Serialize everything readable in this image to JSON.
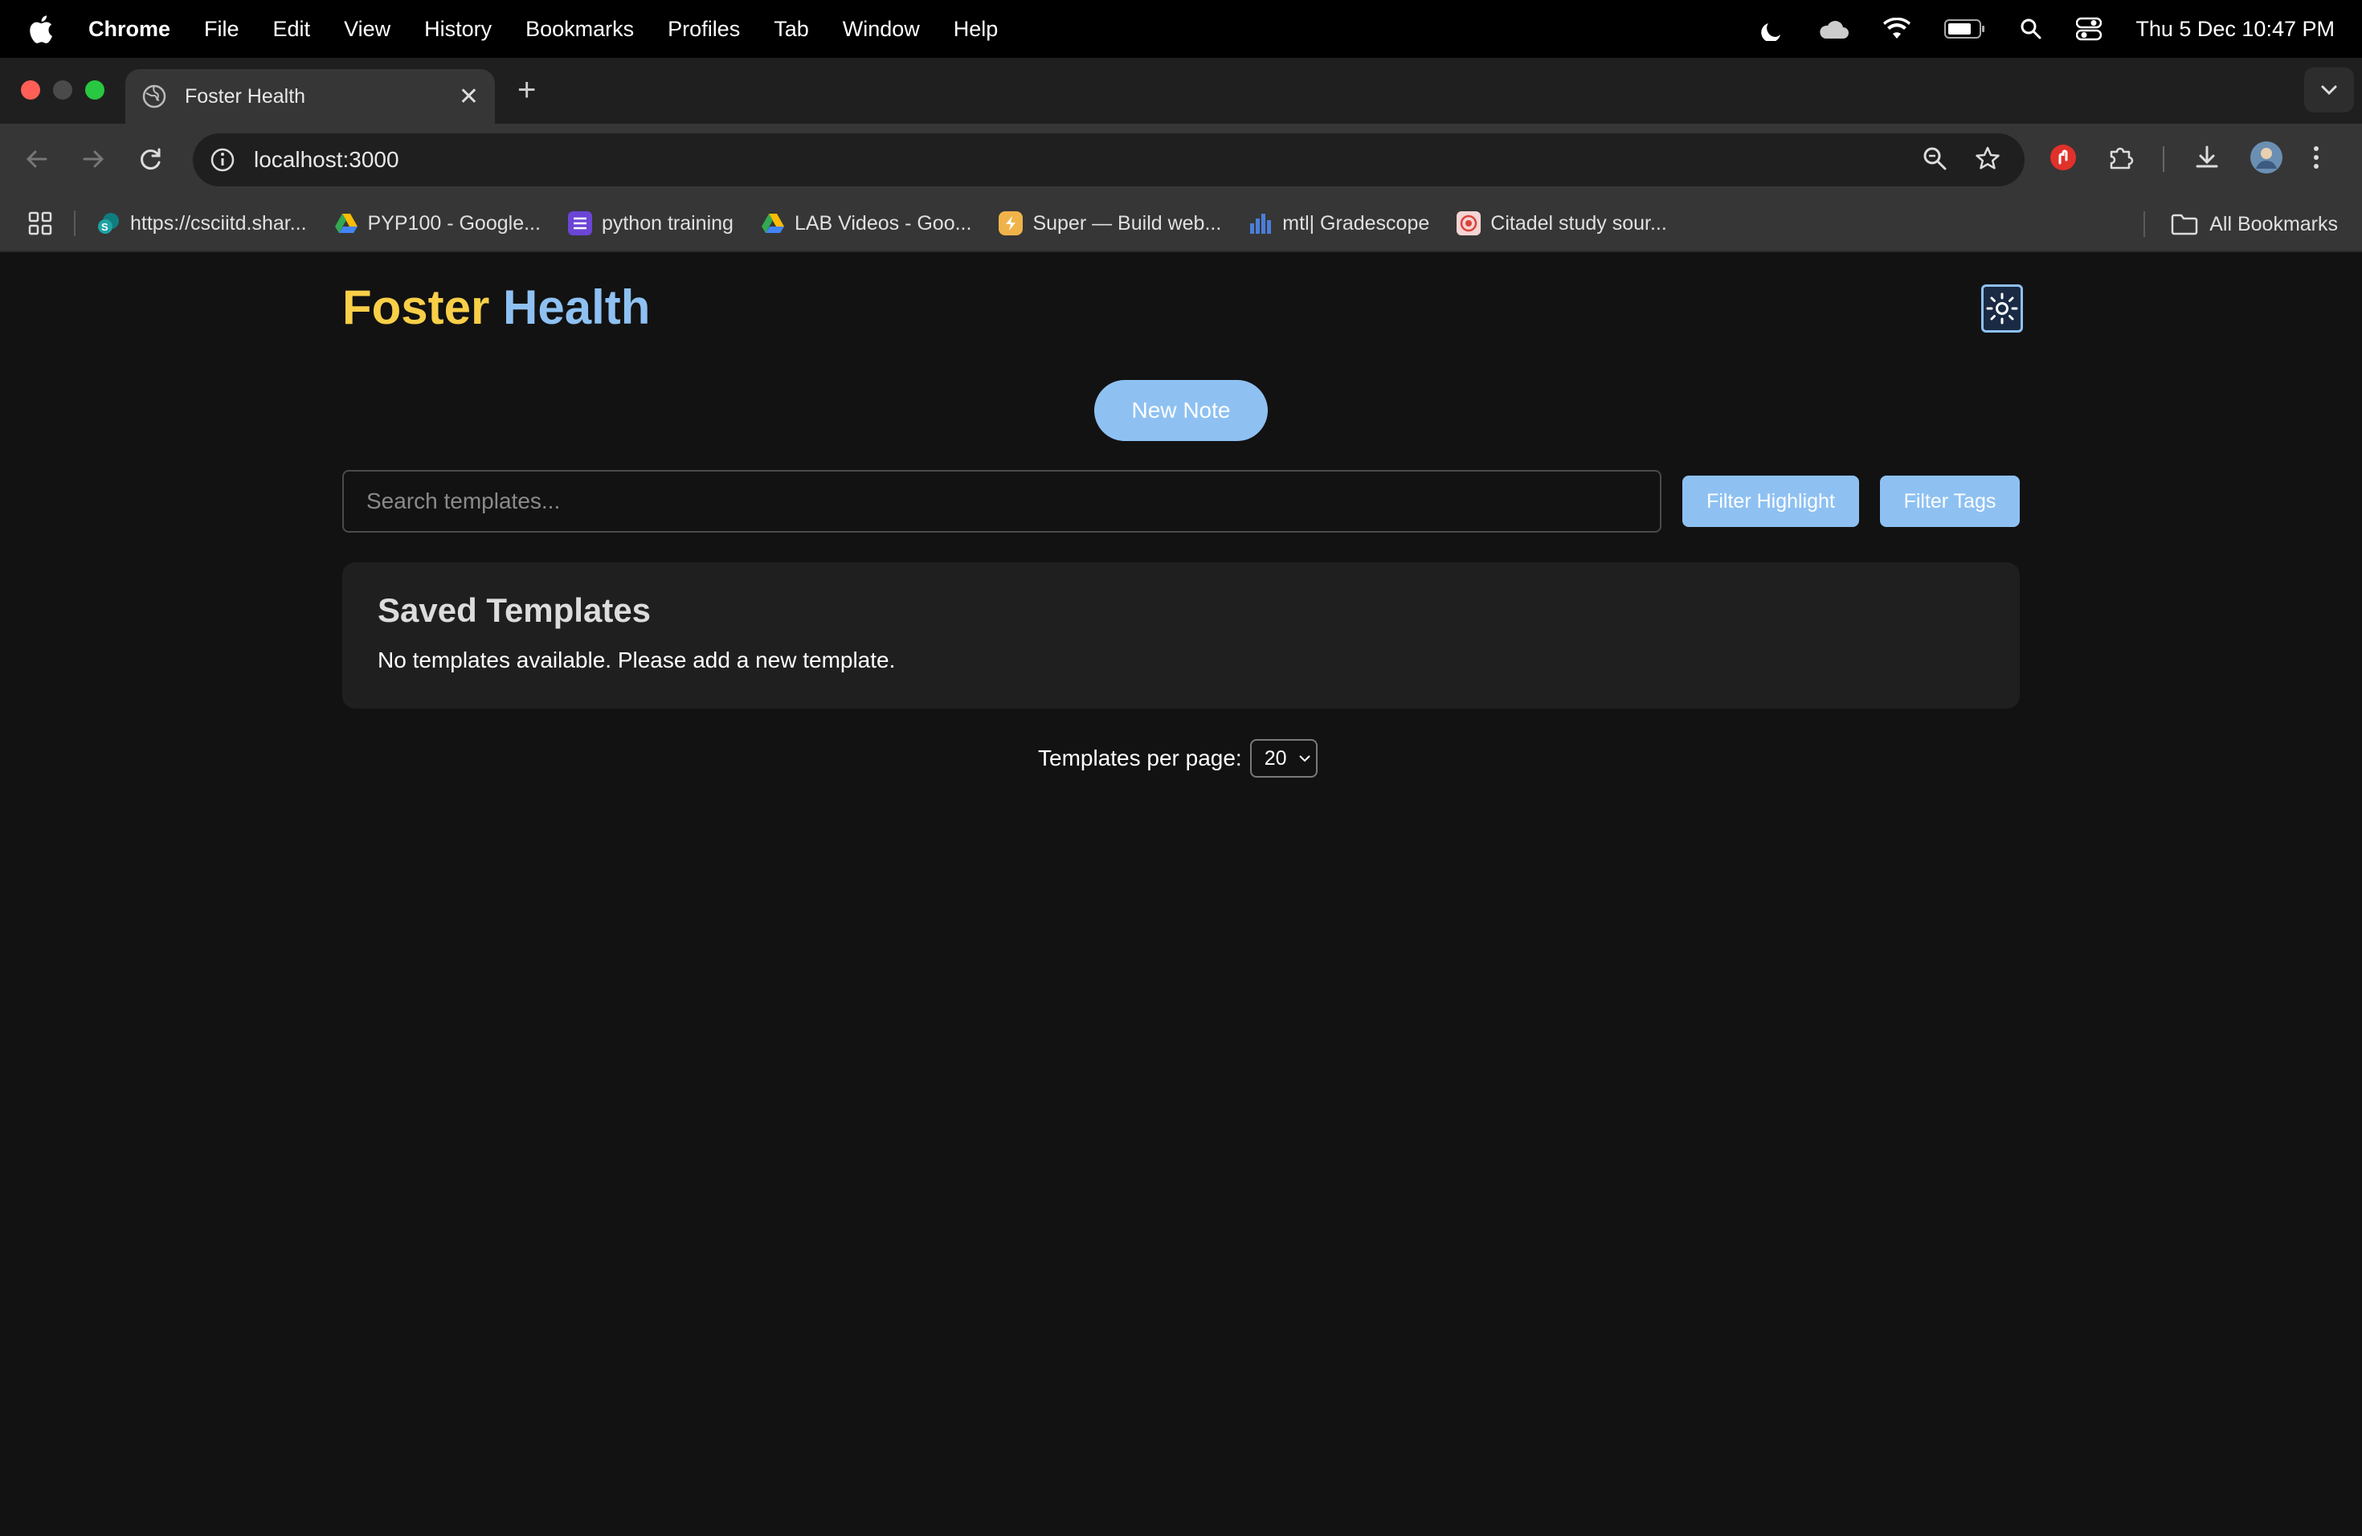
{
  "menubar": {
    "app_name": "Chrome",
    "items": [
      "File",
      "Edit",
      "View",
      "History",
      "Bookmarks",
      "Profiles",
      "Tab",
      "Window",
      "Help"
    ],
    "clock": "Thu 5 Dec  10:47 PM"
  },
  "tab": {
    "title": "Foster Health",
    "close": "✕",
    "new_tab": "+"
  },
  "address_bar": {
    "url": "localhost:3000"
  },
  "bookmarks": [
    {
      "label": "https://csciitd.shar...",
      "icon": "sharepoint-icon"
    },
    {
      "label": "PYP100 - Google...",
      "icon": "google-drive-icon"
    },
    {
      "label": "python training",
      "icon": "list-icon"
    },
    {
      "label": "LAB Videos - Goo...",
      "icon": "google-drive-icon"
    },
    {
      "label": "Super — Build web...",
      "icon": "super-icon"
    },
    {
      "label": "mtl| Gradescope",
      "icon": "bar-chart-icon"
    },
    {
      "label": "Citadel study sour...",
      "icon": "citadel-icon"
    }
  ],
  "all_bookmarks": "All Bookmarks",
  "app": {
    "logo_word1": "Foster",
    "logo_word2": "Health",
    "new_note": "New Note",
    "search_placeholder": "Search templates...",
    "filter_highlight": "Filter Highlight",
    "filter_tags": "Filter Tags",
    "saved_title": "Saved Templates",
    "empty_message": "No templates available. Please add a new template.",
    "per_page_label": "Templates per page:",
    "per_page_value": "20"
  },
  "colors": {
    "logo_yellow": "#f9cf48",
    "accent_blue": "#8ec1f2",
    "background": "#121212",
    "card": "#1f1f1f"
  }
}
